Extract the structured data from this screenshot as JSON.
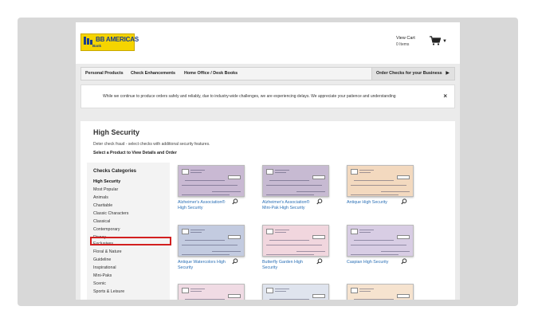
{
  "brand": {
    "name": "BB AMERICAS",
    "sub": "Bank"
  },
  "cart": {
    "label": "View Cart",
    "items": "0 Items"
  },
  "nav": {
    "items": [
      "Personal Products",
      "Check Enhancements",
      "Home Office / Desk Books"
    ],
    "cta": "Order Checks for your Business"
  },
  "notice": {
    "message": "While we continue to produce orders safely and reliably, due to industry-wide challenges, we are experiencing delays. We appreciate your patience and understanding",
    "close": "×"
  },
  "page": {
    "title": "High Security",
    "subtitle": "Deter check fraud - select checks with additional security features.",
    "instruction": "Select a Product to View Details and Order"
  },
  "sidebar": {
    "heading": "Checks Categories",
    "items": [
      "High Security",
      "Most Popular",
      "Animals",
      "Charitable",
      "Classic Characters",
      "Classical",
      "Contemporary",
      "Disney",
      "Exclusives",
      "Floral & Nature",
      "Guideline",
      "Inspirational",
      "Mini-Paks",
      "Scenic",
      "Sports & Leisure"
    ],
    "active": "High Security",
    "highlighted": "Exclusives"
  },
  "products": [
    {
      "name": "Alzheimer's Association® High Security",
      "color": "#c9b9d3"
    },
    {
      "name": "Alzheimer's Association® Mini-Pak High Security",
      "color": "#c7bad2"
    },
    {
      "name": "Antique High Security",
      "color": "#f3d9bf"
    },
    {
      "name": "Antique Watercolors High Security",
      "color": "#c3cbe0"
    },
    {
      "name": "Butterfly Garden High Security",
      "color": "#f1d6de"
    },
    {
      "name": "Caspian High Security",
      "color": "#d8cde4"
    }
  ],
  "bottom_row_colors": [
    "#f0dbe4",
    "#dfe4ee",
    "#f6e3cf"
  ],
  "colors": {
    "brand_yellow": "#f5d400",
    "brand_blue": "#1a3e8c",
    "link": "#2a6fb5",
    "highlight": "#d21f1f"
  }
}
